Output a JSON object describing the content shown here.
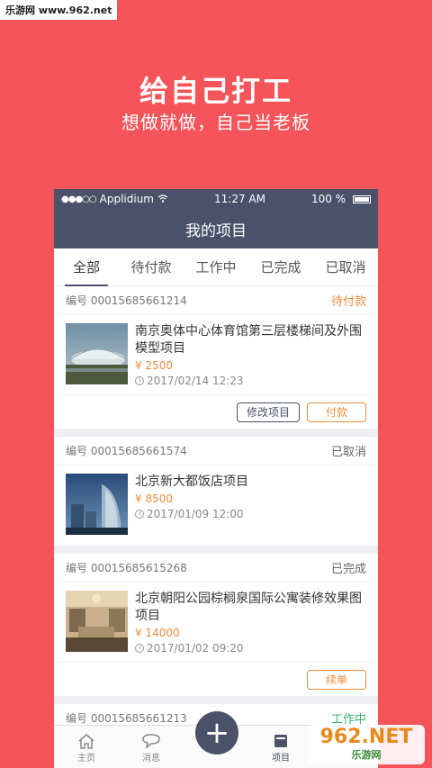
{
  "watermark_top": "乐游网 www.962.net",
  "promo": {
    "title": "给自己打工",
    "subtitle": "想做就做，自己当老板"
  },
  "statusbar": {
    "carrier": "Applidium",
    "time": "11:27 AM",
    "battery": "100 %"
  },
  "navbar": {
    "title": "我的项目"
  },
  "tabs": [
    {
      "label": "全部",
      "active": true
    },
    {
      "label": "待付款",
      "active": false
    },
    {
      "label": "工作中",
      "active": false
    },
    {
      "label": "已完成",
      "active": false
    },
    {
      "label": "已取消",
      "active": false
    }
  ],
  "cards": [
    {
      "number_label": "编号",
      "number": "00015685661214",
      "status": "待付款",
      "title": "南京奥体中心体育馆第三层楼梯间及外围模型项目",
      "price": "¥ 2500",
      "time": "2017/02/14 12:23",
      "buttons": [
        "修改项目",
        "付款"
      ]
    },
    {
      "number_label": "编号",
      "number": "00015685661574",
      "status": "已取消",
      "title": "北京新大都饭店项目",
      "price": "¥ 8500",
      "time": "2017/01/09 12:00"
    },
    {
      "number_label": "编号",
      "number": "00015685615268",
      "status": "已完成",
      "title": "北京朝阳公园棕榈泉国际公寓装修效果图项目",
      "price": "¥ 14000",
      "time": "2017/01/02 09:20",
      "buttons": [
        "续单"
      ]
    },
    {
      "number_label": "编号",
      "number": "00015685661213",
      "status": "工作中"
    }
  ],
  "tabbar": {
    "home": "主页",
    "messages": "消息",
    "projects": "项目",
    "add": "+"
  },
  "watermark_bottom": {
    "big": "962.NET",
    "small": "乐游网"
  },
  "colors": {
    "brand_red": "#f4545a",
    "navy": "#4a5168",
    "orange": "#f08a3c",
    "green": "#3cb371"
  }
}
